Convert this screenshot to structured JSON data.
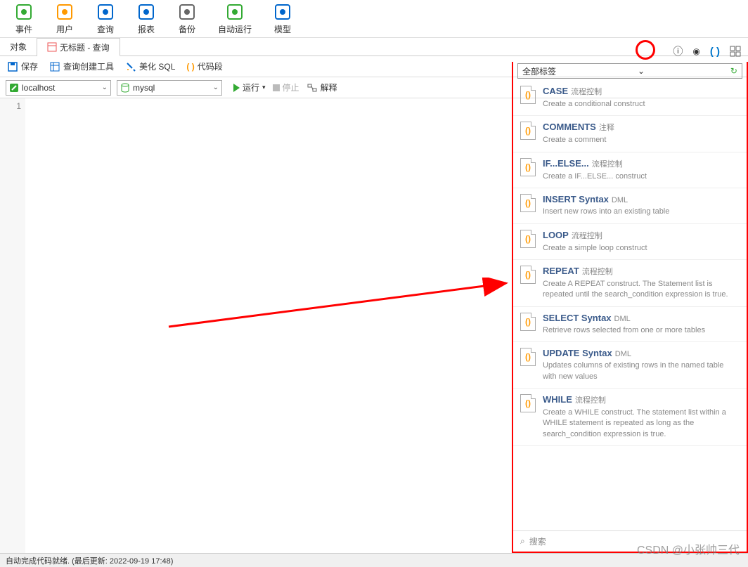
{
  "toolbar": [
    {
      "label": "事件",
      "icon": "clock-icon",
      "color": "#3a3"
    },
    {
      "label": "用户",
      "icon": "user-icon",
      "color": "#f90"
    },
    {
      "label": "查询",
      "icon": "query-icon",
      "color": "#06c"
    },
    {
      "label": "报表",
      "icon": "report-icon",
      "color": "#06c"
    },
    {
      "label": "备份",
      "icon": "backup-icon",
      "color": "#666"
    },
    {
      "label": "自动运行",
      "icon": "auto-icon",
      "color": "#3a3"
    },
    {
      "label": "模型",
      "icon": "model-icon",
      "color": "#06c"
    }
  ],
  "tabs": [
    {
      "label": "对象"
    },
    {
      "label": "无标题 - 查询",
      "active": true
    }
  ],
  "actions": {
    "save": "保存",
    "builder": "查询创建工具",
    "beautify": "美化 SQL",
    "snippet": "代码段"
  },
  "conn": {
    "host": "localhost",
    "db": "mysql",
    "run": "运行",
    "stop": "停止",
    "explain": "解释"
  },
  "editor": {
    "line1": "1"
  },
  "side": {
    "filter": "全部标签",
    "search_placeholder": "搜索",
    "snippets": [
      {
        "title": "CASE",
        "tag": "流程控制",
        "desc": "Create a conditional construct"
      },
      {
        "title": "COMMENTS",
        "tag": "注释",
        "desc": "Create a comment"
      },
      {
        "title": "IF...ELSE...",
        "tag": "流程控制",
        "desc": "Create a IF...ELSE... construct"
      },
      {
        "title": "INSERT Syntax",
        "tag": "DML",
        "desc": "Insert new rows into an existing table"
      },
      {
        "title": "LOOP",
        "tag": "流程控制",
        "desc": "Create a simple loop construct"
      },
      {
        "title": "REPEAT",
        "tag": "流程控制",
        "desc": "Create A REPEAT construct. The Statement list is repeated until the search_condition expression is true."
      },
      {
        "title": "SELECT Syntax",
        "tag": "DML",
        "desc": "Retrieve rows selected from one or more tables"
      },
      {
        "title": "UPDATE Syntax",
        "tag": "DML",
        "desc": "Updates columns of existing rows in the named table with new values"
      },
      {
        "title": "WHILE",
        "tag": "流程控制",
        "desc": "Create a WHILE construct. The statement list within a WHILE statement is repeated as long as the search_condition expression is true."
      }
    ]
  },
  "status": "自动完成代码就绪. (最后更新: 2022-09-19 17:48)",
  "watermark": "CSDN @小张帅三代"
}
